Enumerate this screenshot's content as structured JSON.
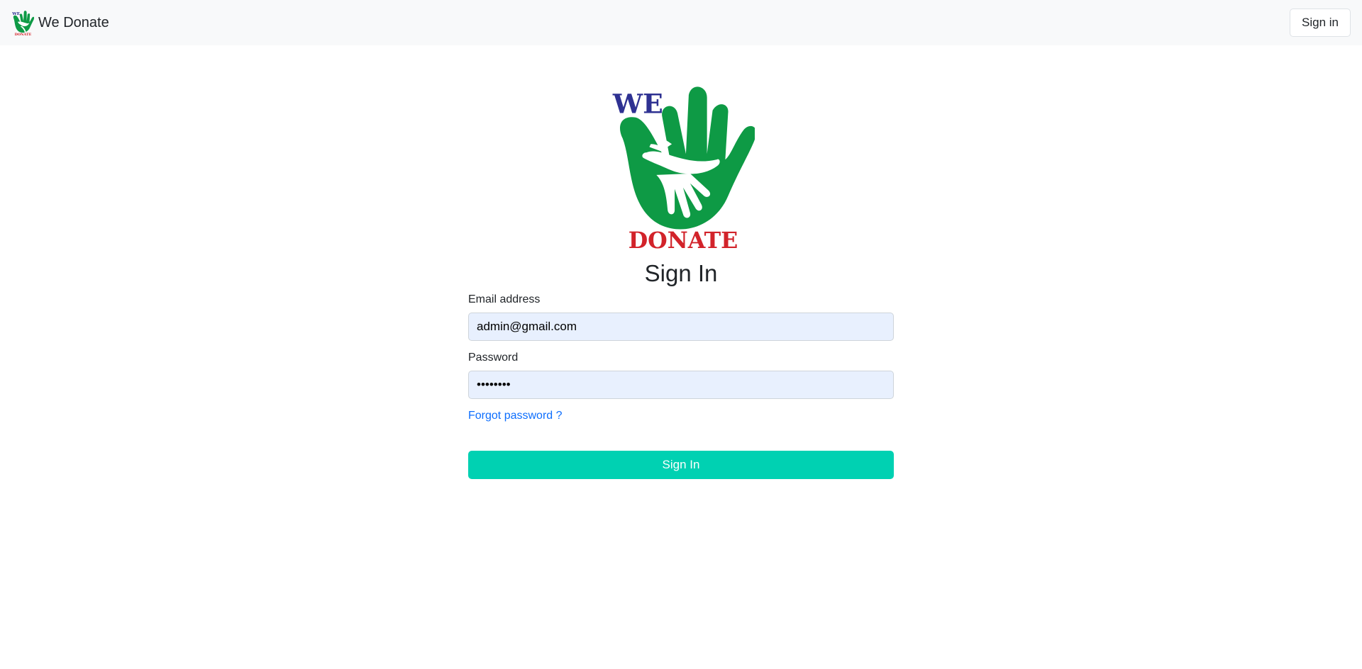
{
  "navbar": {
    "brand_text": "We Donate",
    "signin_label": "Sign in"
  },
  "form": {
    "title": "Sign In",
    "email_label": "Email address",
    "email_value": "admin@gmail.com",
    "password_label": "Password",
    "password_value": "••••••••",
    "forgot_label": "Forgot password ?",
    "submit_label": "Sign In"
  },
  "logo": {
    "top_text": "WE",
    "bottom_text": "DONATE",
    "colors": {
      "green": "#0e9a45",
      "blue": "#2e3192",
      "red": "#d2232a"
    }
  },
  "colors": {
    "accent": "#00d1b2",
    "link": "#0d6efd",
    "input_bg": "#e8f0fe",
    "navbar_bg": "#f8f9fa"
  }
}
